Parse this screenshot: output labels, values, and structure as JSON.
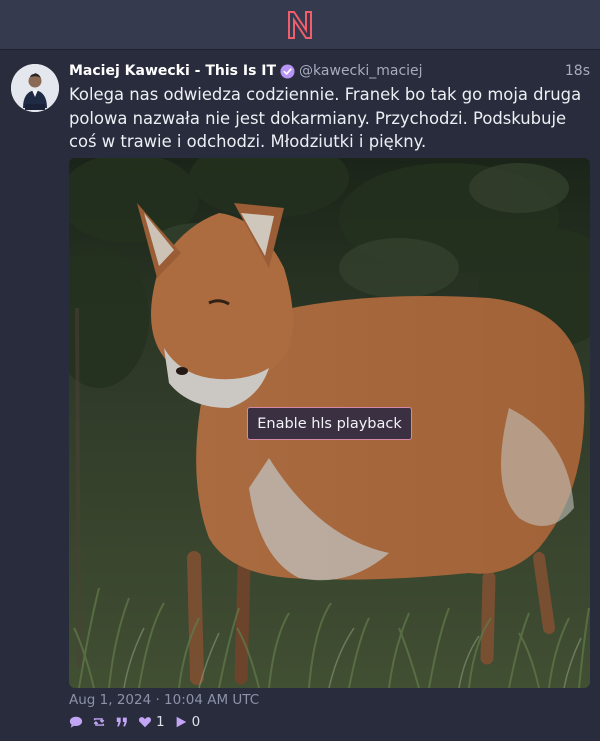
{
  "app": {
    "logo_letter": "N",
    "accent_color": "#c3a5f5",
    "logo_color": "#f05d6b"
  },
  "post": {
    "author_name": "Maciej Kawecki - This Is IT",
    "verified_icon": "verified-check-icon",
    "handle": "@kawecki_maciej",
    "relative_time": "18s",
    "text": "Kolega nas odwiedza codziennie. Franek bo tak go moja druga polowa nazwała nie jest dokarmiany. Przychodzi. Podskubuje coś w trawie i odchodzi. Młodziutki i piękny.",
    "media": {
      "description_icon": "video-thumbnail",
      "play_button_label": "Enable hls playback"
    },
    "timestamp": "Aug 1, 2024 · 10:04 AM UTC",
    "actions": {
      "reply_icon": "reply-bubble-icon",
      "repost_icon": "repost-icon",
      "quote_icon": "quote-icon",
      "like_icon": "heart-icon",
      "like_count": "1",
      "views_icon": "play-views-icon",
      "views_count": "0"
    }
  }
}
